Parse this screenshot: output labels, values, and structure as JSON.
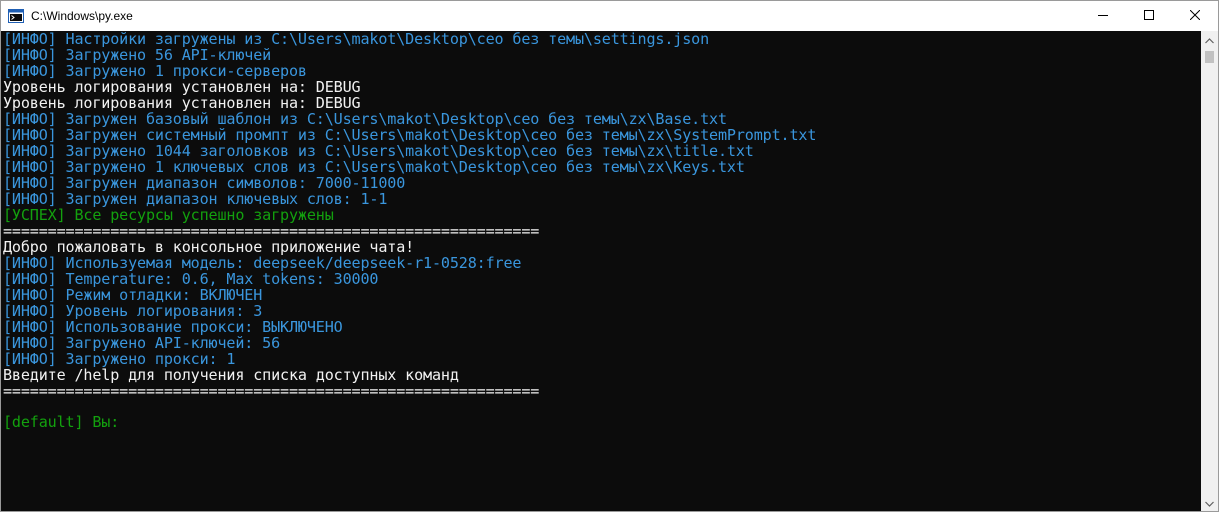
{
  "window": {
    "title": "C:\\Windows\\py.exe"
  },
  "console": {
    "lines": [
      {
        "text": "[ИНФО] Настройки загружены из C:\\Users\\makot\\Desktop\\сео без темы\\settings.json",
        "color": "#3a96dd"
      },
      {
        "text": "[ИНФО] Загружено 56 API-ключей",
        "color": "#3a96dd"
      },
      {
        "text": "[ИНФО] Загружено 1 прокси-серверов",
        "color": "#3a96dd"
      },
      {
        "text": "Уровень логирования установлен на: DEBUG",
        "color": "#f2f2f2"
      },
      {
        "text": "Уровень логирования установлен на: DEBUG",
        "color": "#f2f2f2"
      },
      {
        "text": "[ИНФО] Загружен базовый шаблон из C:\\Users\\makot\\Desktop\\сео без темы\\zx\\Base.txt",
        "color": "#3a96dd"
      },
      {
        "text": "[ИНФО] Загружен системный промпт из C:\\Users\\makot\\Desktop\\сео без темы\\zx\\SystemPrompt.txt",
        "color": "#3a96dd"
      },
      {
        "text": "[ИНФО] Загружено 1044 заголовков из C:\\Users\\makot\\Desktop\\сео без темы\\zx\\title.txt",
        "color": "#3a96dd"
      },
      {
        "text": "[ИНФО] Загружено 1 ключевых слов из C:\\Users\\makot\\Desktop\\сео без темы\\zx\\Keys.txt",
        "color": "#3a96dd"
      },
      {
        "text": "[ИНФО] Загружен диапазон символов: 7000-11000",
        "color": "#3a96dd"
      },
      {
        "text": "[ИНФО] Загружен диапазон ключевых слов: 1-1",
        "color": "#3a96dd"
      },
      {
        "text": "[УСПЕХ] Все ресурсы успешно загружены",
        "color": "#13a10e"
      },
      {
        "text": "============================================================",
        "color": "#f2f2f2"
      },
      {
        "text": "Добро пожаловать в консольное приложение чата!",
        "color": "#f2f2f2"
      },
      {
        "text": "[ИНФО] Используемая модель: deepseek/deepseek-r1-0528:free",
        "color": "#3a96dd"
      },
      {
        "text": "[ИНФО] Temperature: 0.6, Max tokens: 30000",
        "color": "#3a96dd"
      },
      {
        "text": "[ИНФО] Режим отладки: ВКЛЮЧЕН",
        "color": "#3a96dd"
      },
      {
        "text": "[ИНФО] Уровень логирования: 3",
        "color": "#3a96dd"
      },
      {
        "text": "[ИНФО] Использование прокси: ВЫКЛЮЧЕНО",
        "color": "#3a96dd"
      },
      {
        "text": "[ИНФО] Загружено API-ключей: 56",
        "color": "#3a96dd"
      },
      {
        "text": "[ИНФО] Загружено прокси: 1",
        "color": "#3a96dd"
      },
      {
        "text": "Введите /help для получения списка доступных команд",
        "color": "#f2f2f2"
      },
      {
        "text": "============================================================",
        "color": "#f2f2f2"
      }
    ],
    "prompt": {
      "text": "[default] Вы:",
      "color": "#13a10e"
    }
  },
  "icons": {
    "app": "python-console-icon",
    "minimize": "minimize-icon",
    "maximize": "maximize-icon",
    "close": "close-icon",
    "scroll_up": "scroll-up-arrow-icon",
    "scroll_down": "scroll-down-arrow-icon"
  }
}
